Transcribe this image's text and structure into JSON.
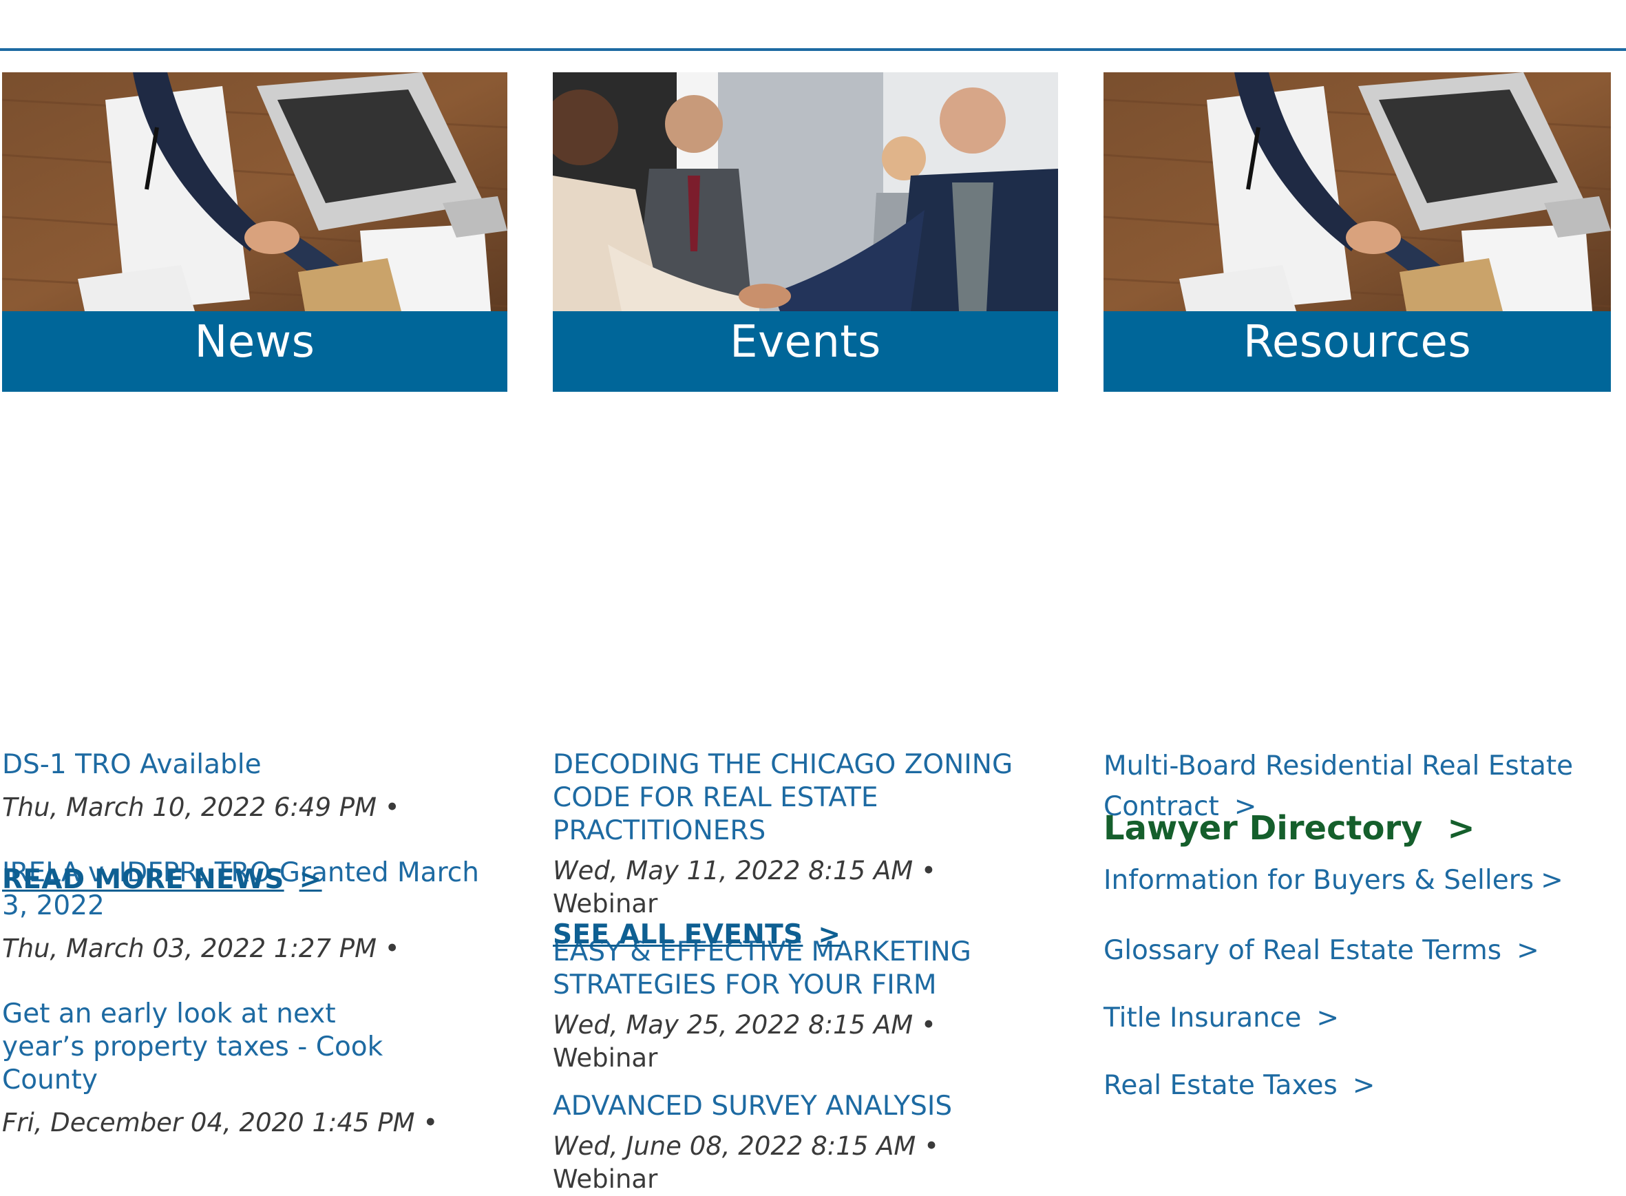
{
  "news": {
    "header": "News",
    "items": [
      {
        "title": "DS-1 TRO Available",
        "date": "Thu, March 10, 2022 6:49 PM",
        "sep": "•"
      },
      {
        "title": "IRELA v. IDFPR: TRO Granted March 3, 2022",
        "date": "Thu, March 03, 2022 1:27 PM",
        "sep": "•"
      },
      {
        "title": "Get an early look at next year’s property taxes - Cook County",
        "date": "Fri, December 04, 2020 1:45 PM",
        "sep": "•"
      }
    ],
    "more_label": "READ MORE NEWS",
    "more_arrow": ">"
  },
  "events": {
    "header": "Events",
    "items": [
      {
        "title": "DECODING THE CHICAGO ZONING CODE FOR REAL ESTATE PRACTITIONERS",
        "date": "Wed, May 11, 2022 8:15 AM",
        "location": "• Webinar"
      },
      {
        "title": "EASY & EFFECTIVE MARKETING STRATEGIES FOR YOUR FIRM",
        "date": "Wed, May 25, 2022 8:15 AM",
        "location": "• Webinar"
      },
      {
        "title": "ADVANCED SURVEY ANALYSIS",
        "date": "Wed, June 08, 2022 8:15 AM",
        "location": "• Webinar"
      }
    ],
    "more_label": "SEE ALL EVENTS",
    "more_arrow": ">"
  },
  "resources": {
    "header": "Resources",
    "items": [
      {
        "label": "Multi-Board Residential Real Estate Contract",
        "arrow": ">"
      },
      {
        "label": "Information for Buyers & Sellers",
        "arrow": ">"
      },
      {
        "label": "Glossary of Real Estate Terms",
        "arrow": ">"
      },
      {
        "label": "Title Insurance",
        "arrow": ">"
      },
      {
        "label": "Real Estate Taxes",
        "arrow": ">"
      }
    ],
    "lawyer_label": "Lawyer Directory",
    "lawyer_arrow": ">"
  },
  "colors": {
    "banner": "#006699",
    "link": "#1d6aa2",
    "lawyer": "#155f2c",
    "rule": "#1d6aa2"
  },
  "images": {
    "news": "handshake-over-desk-with-laptop",
    "events": "business-people-handshake",
    "resources": "handshake-over-desk-with-laptop"
  }
}
